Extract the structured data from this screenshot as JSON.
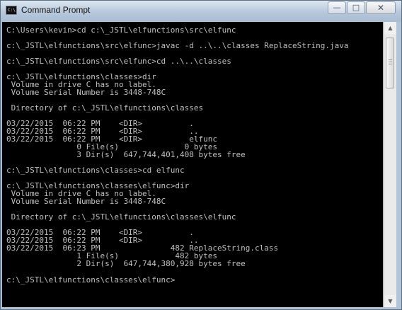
{
  "window": {
    "title": "Command Prompt",
    "icon": "console-icon",
    "icon_text": "C:\\",
    "controls": {
      "minimize": "—",
      "maximize": "□",
      "close": "✕"
    }
  },
  "console": {
    "text": "C:\\Users\\kevin>cd c:\\_JSTL\\elfunctions\\src\\elfunc\n\nc:\\_JSTL\\elfunctions\\src\\elfunc>javac -d ..\\..\\classes ReplaceString.java\n\nc:\\_JSTL\\elfunctions\\src\\elfunc>cd ..\\..\\classes\n\nc:\\_JSTL\\elfunctions\\classes>dir\n Volume in drive C has no label.\n Volume Serial Number is 3448-748C\n\n Directory of c:\\_JSTL\\elfunctions\\classes\n\n03/22/2015  06:22 PM    <DIR>          .\n03/22/2015  06:22 PM    <DIR>          ..\n03/22/2015  06:22 PM    <DIR>          elfunc\n               0 File(s)              0 bytes\n               3 Dir(s)  647,744,401,408 bytes free\n\nc:\\_JSTL\\elfunctions\\classes>cd elfunc\n\nc:\\_JSTL\\elfunctions\\classes\\elfunc>dir\n Volume in drive C has no label.\n Volume Serial Number is 3448-748C\n\n Directory of c:\\_JSTL\\elfunctions\\classes\\elfunc\n\n03/22/2015  06:22 PM    <DIR>          .\n03/22/2015  06:22 PM    <DIR>          ..\n03/22/2015  06:23 PM               482 ReplaceString.class\n               1 File(s)            482 bytes\n               2 Dir(s)  647,744,380,928 bytes free\n\nc:\\_JSTL\\elfunctions\\classes\\elfunc>"
  },
  "scrollbar": {
    "up_arrow": "▲",
    "down_arrow": "▼",
    "up_icon": "arrow-up-icon",
    "down_icon": "arrow-down-icon"
  },
  "colors": {
    "console_background": "#000000",
    "console_text": "#c0c0c0",
    "window_frame": "#a9bdd3"
  }
}
